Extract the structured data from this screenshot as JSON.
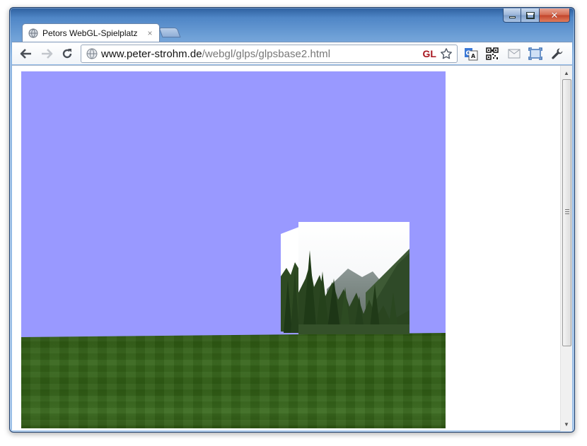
{
  "window": {
    "controls": {
      "minimize": "minimize",
      "maximize": "maximize",
      "close": "close"
    }
  },
  "tab": {
    "title": "Petors WebGL-Spielplatz",
    "close_glyph": "×",
    "icon": "globe-icon"
  },
  "toolbar": {
    "back_icon": "back-arrow-icon",
    "forward_icon": "forward-arrow-icon",
    "reload_icon": "reload-icon",
    "url_host": "www.peter-strohm.de",
    "url_path": "/webgl/glps/glpsbase2.html",
    "gl_badge": "GL",
    "bookmark_icon": "star-icon",
    "extensions": [
      "translate-icon",
      "qr-code-icon",
      "mail-icon",
      "fullscreen-icon",
      "wrench-icon"
    ]
  },
  "scene": {
    "sky_color": "#9999ff",
    "ground_color": "#36651a",
    "object": "textured-cube"
  },
  "colors": {
    "chrome_frame": "#4f86c6",
    "gl_badge": "#a8161f"
  }
}
